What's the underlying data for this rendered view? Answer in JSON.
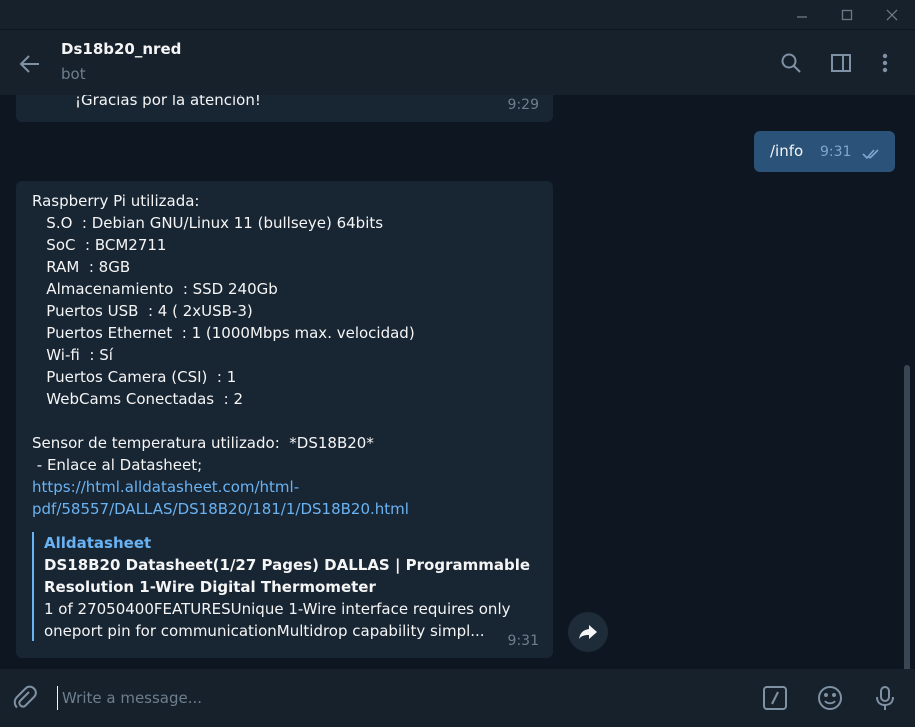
{
  "chat": {
    "title": "Ds18b20_nred",
    "status": "bot"
  },
  "messages": {
    "prev": {
      "text": "¡Gracias por la atención!",
      "time": "9:29"
    },
    "outgoing": {
      "text": "/info",
      "time": "9:31"
    },
    "info": {
      "lines": [
        "Raspberry Pi utilizada:",
        "   S.O  : Debian GNU/Linux 11 (bullseye) 64bits",
        "   SoC  : BCM2711",
        "   RAM  : 8GB",
        "   Almacenamiento  : SSD 240Gb",
        "   Puertos USB  : 4 ( 2xUSB-3)",
        "   Puertos Ethernet  : 1 (1000Mbps max. velocidad)",
        "   Wi-fi  : Sí",
        "   Puertos Camera (CSI)  : 1",
        "   WebCams Conectadas  : 2",
        "",
        "Sensor de temperatura utilizado:  *DS18B20*",
        " - Enlace al Datasheet;"
      ],
      "link_line1": "https://html.alldatasheet.com/html-",
      "link_line2": "pdf/58557/DALLAS/DS18B20/181/1/DS18B20.html",
      "preview": {
        "site": "Alldatasheet",
        "title_line1": "DS18B20 Datasheet(1/27 Pages) DALLAS | Programmable",
        "title_line2": "Resolution 1-Wire Digital Thermometer",
        "desc_line1": "1 of 27050400FEATURESUnique 1-Wire interface requires only",
        "desc_line2": "oneport pin for communicationMultidrop capability simpl..."
      },
      "time": "9:31"
    }
  },
  "composer": {
    "placeholder": "Write a message..."
  },
  "icons": {
    "minimize": "minimize-icon",
    "maximize": "maximize-icon",
    "close": "close-icon",
    "back": "back-arrow-icon",
    "search": "search-icon",
    "sidebar": "sidebar-toggle-icon",
    "more": "more-vertical-icon",
    "share": "share-icon",
    "attach": "paperclip-icon",
    "commands": "bot-commands-icon",
    "emoji": "emoji-icon",
    "mic": "microphone-icon"
  },
  "colors": {
    "background": "#0e1621",
    "panel": "#17212b",
    "incoming_bubble": "#182533",
    "outgoing_bubble": "#2b5278",
    "link": "#6ab3f3",
    "muted": "#6d7f8f"
  }
}
